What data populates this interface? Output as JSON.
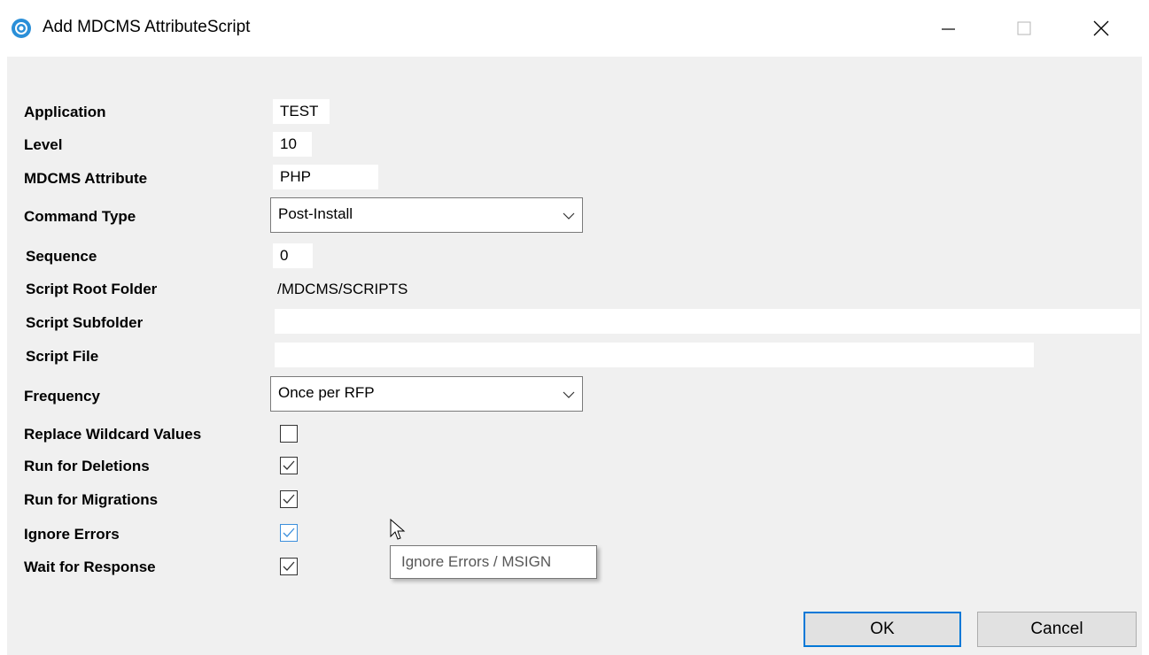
{
  "window": {
    "title": "Add MDCMS AttributeScript"
  },
  "fields": {
    "application_label": "Application",
    "application_value": "TEST",
    "level_label": "Level",
    "level_value": "10",
    "attribute_label": "MDCMS Attribute",
    "attribute_value": "PHP",
    "command_type_label": "Command Type",
    "command_type_value": "Post-Install",
    "sequence_label": "Sequence",
    "sequence_value": "0",
    "root_folder_label": "Script Root Folder",
    "root_folder_value": "/MDCMS/SCRIPTS",
    "subfolder_label": "Script Subfolder",
    "subfolder_value": "",
    "script_file_label": "Script File",
    "script_file_value": "",
    "frequency_label": "Frequency",
    "frequency_value": "Once per RFP"
  },
  "checkboxes": [
    {
      "label": "Replace Wildcard Values",
      "checked": false
    },
    {
      "label": "Run for Deletions",
      "checked": true
    },
    {
      "label": "Run for Migrations",
      "checked": true
    },
    {
      "label": "Ignore Errors",
      "checked": true
    },
    {
      "label": "Wait for Response",
      "checked": true
    }
  ],
  "tooltip": "Ignore Errors / MSIGN",
  "buttons": {
    "ok": "OK",
    "cancel": "Cancel"
  },
  "colors": {
    "accent": "#0078d7",
    "client_bg": "#f0f0f0",
    "app_icon": "#2a8fd8"
  },
  "icons": [
    "app-icon",
    "minimize-icon",
    "maximize-icon",
    "close-icon",
    "chevron-down-icon",
    "checkmark-icon",
    "mouse-cursor-icon"
  ]
}
